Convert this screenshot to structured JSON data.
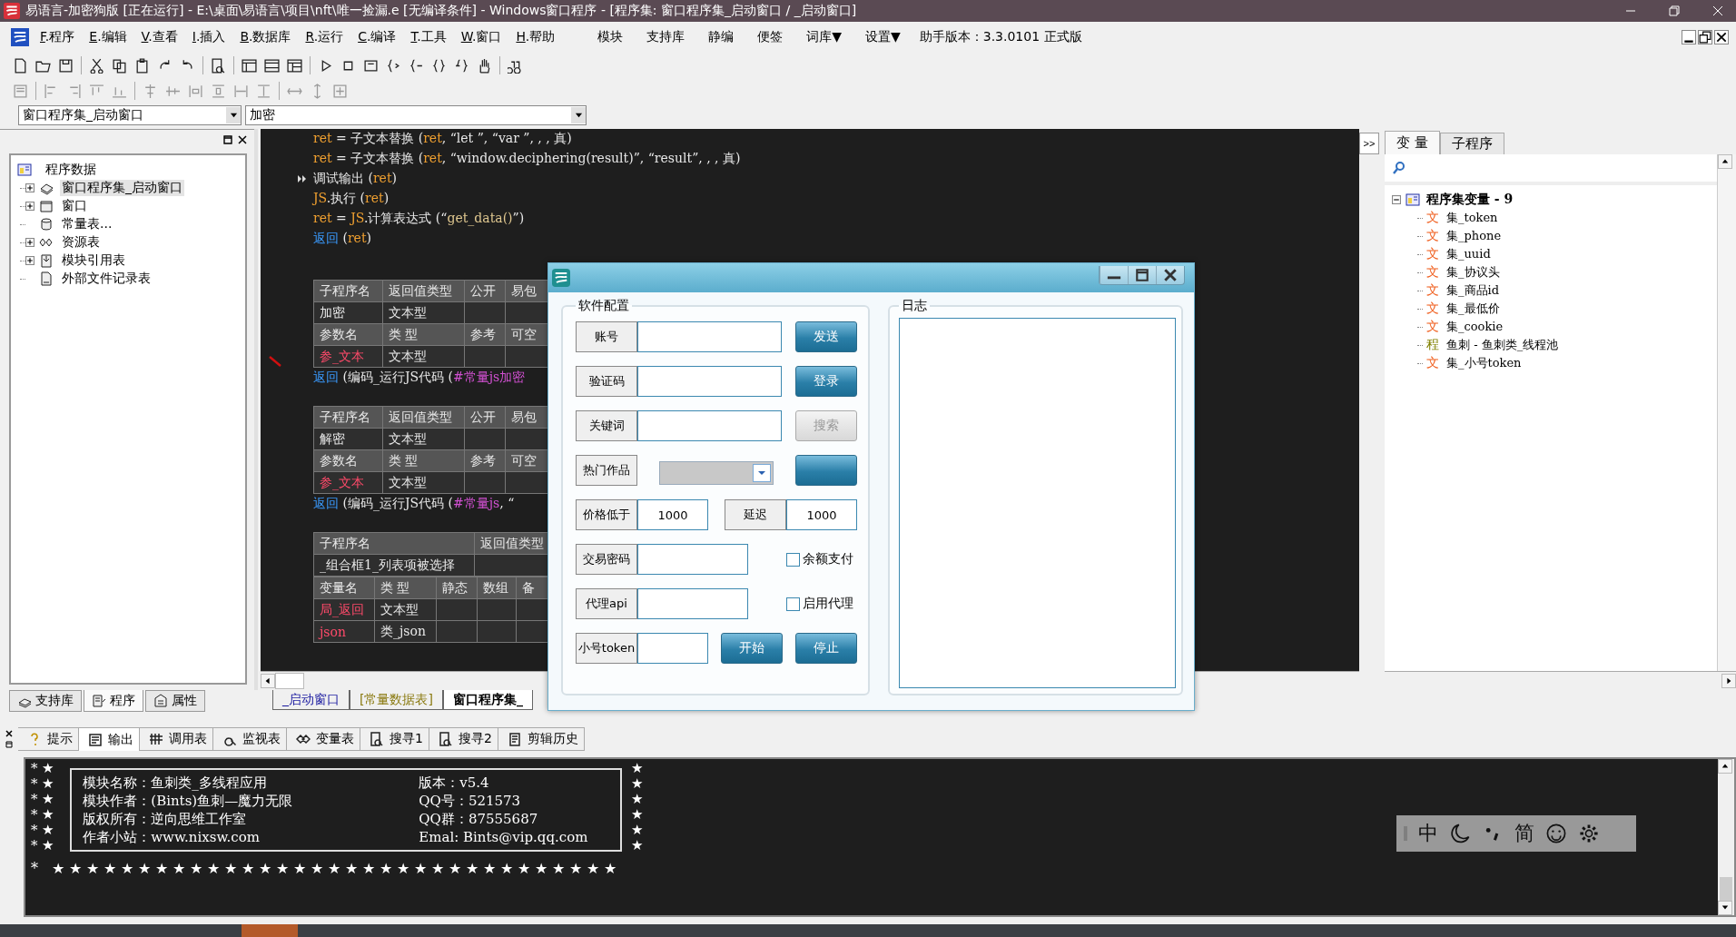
{
  "window": {
    "title": "易语言-加密狗版 [正在运行] - E:\\桌面\\易语言\\项目\\nft\\唯一捡漏.e [无编译条件] - Windows窗口程序 - [程序集: 窗口程序集_启动窗口 / _启动窗口]"
  },
  "menu": {
    "items": [
      {
        "key": "F",
        "label": ".程序"
      },
      {
        "key": "E",
        "label": ".编辑"
      },
      {
        "key": "V",
        "label": ".查看"
      },
      {
        "key": "I",
        "label": ".插入"
      },
      {
        "key": "B",
        "label": ".数据库"
      },
      {
        "key": "R",
        "label": ".运行"
      },
      {
        "key": "C",
        "label": ".编译"
      },
      {
        "key": "T",
        "label": ".工具"
      },
      {
        "key": "W",
        "label": ".窗口"
      },
      {
        "key": "H",
        "label": ".帮助"
      }
    ],
    "extras": [
      "模块",
      "支持库",
      "静编",
      "便签",
      "词库▼",
      "设置▼"
    ],
    "version": "助手版本：3.3.0101 正式版"
  },
  "selectors": {
    "assembly": "窗口程序集_启动窗口",
    "subroutine": "加密"
  },
  "project_tree": {
    "root": "程序数据",
    "children": [
      {
        "label": "窗口程序集_启动窗口",
        "expandable": true,
        "selected": true
      },
      {
        "label": "窗口",
        "expandable": true,
        "selected": false
      },
      {
        "label": "常量表...",
        "expandable": false,
        "selected": false
      },
      {
        "label": "资源表",
        "expandable": true,
        "selected": false
      },
      {
        "label": "模块引用表",
        "expandable": true,
        "selected": false
      },
      {
        "label": "外部文件记录表",
        "expandable": false,
        "selected": false
      }
    ]
  },
  "left_tabs": [
    {
      "label": "支持库",
      "selected": false
    },
    {
      "label": "程序",
      "selected": true
    },
    {
      "label": "属性",
      "selected": false
    }
  ],
  "code_lines": [
    {
      "current": false,
      "segments": [
        {
          "t": "ret",
          "kind": "var"
        },
        {
          "t": " = 子文本替换 (",
          "kind": "plain"
        },
        {
          "t": "ret",
          "kind": "var"
        },
        {
          "t": ", “let ”, “var ”, , , 真)",
          "kind": "plain"
        }
      ]
    },
    {
      "current": false,
      "segments": [
        {
          "t": "ret",
          "kind": "var"
        },
        {
          "t": " = 子文本替换 (",
          "kind": "plain"
        },
        {
          "t": "ret",
          "kind": "var"
        },
        {
          "t": ", “window.deciphering(result)”, “result”, , , 真)",
          "kind": "plain"
        }
      ]
    },
    {
      "current": true,
      "segments": [
        {
          "t": "调试输出 (",
          "kind": "plain"
        },
        {
          "t": "ret",
          "kind": "var"
        },
        {
          "t": ")",
          "kind": "plain"
        }
      ]
    },
    {
      "current": false,
      "segments": [
        {
          "t": "JS",
          "kind": "var"
        },
        {
          "t": ".执行 (",
          "kind": "plain"
        },
        {
          "t": "ret",
          "kind": "var"
        },
        {
          "t": ")",
          "kind": "plain"
        }
      ]
    },
    {
      "current": false,
      "segments": [
        {
          "t": "ret",
          "kind": "var"
        },
        {
          "t": " = ",
          "kind": "plain"
        },
        {
          "t": "JS",
          "kind": "var"
        },
        {
          "t": ".计算表达式 (“",
          "kind": "plain"
        },
        {
          "t": "get_data()",
          "kind": "str"
        },
        {
          "t": "”)",
          "kind": "plain"
        }
      ]
    },
    {
      "current": false,
      "segments": [
        {
          "t": "返回",
          "kind": "kw"
        },
        {
          "t": " (",
          "kind": "plain"
        },
        {
          "t": "ret",
          "kind": "var"
        },
        {
          "t": ")",
          "kind": "plain"
        }
      ]
    }
  ],
  "code_blocks": [
    {
      "kind": "table",
      "rows": [
        {
          "header": true,
          "cells": [
            {
              "t": "子程序名"
            },
            {
              "t": "返回值类型"
            },
            {
              "t": "公开"
            },
            {
              "t": "易包"
            }
          ]
        },
        {
          "header": false,
          "cells": [
            {
              "t": "加密"
            },
            {
              "t": "文本型"
            },
            {},
            {}
          ]
        },
        {
          "header": true,
          "cells": [
            {
              "t": "参数名"
            },
            {
              "t": "类 型"
            },
            {
              "t": "参考"
            },
            {
              "t": "可空"
            }
          ]
        },
        {
          "header": false,
          "cells": [
            {
              "t": "参_文本",
              "red": true
            },
            {
              "t": "文本型"
            },
            {},
            {}
          ]
        }
      ]
    },
    {
      "kind": "line",
      "segments": [
        {
          "t": "返回",
          "kind": "kw"
        },
        {
          "t": " (编码_运行JS代码 (",
          "kind": "plain"
        },
        {
          "t": "#常量js加密",
          "kind": "const"
        }
      ]
    },
    {
      "kind": "table",
      "rows": [
        {
          "header": true,
          "cells": [
            {
              "t": "子程序名"
            },
            {
              "t": "返回值类型"
            },
            {
              "t": "公开"
            },
            {
              "t": "易包"
            }
          ]
        },
        {
          "header": false,
          "cells": [
            {
              "t": "解密"
            },
            {
              "t": "文本型"
            },
            {},
            {}
          ]
        },
        {
          "header": true,
          "cells": [
            {
              "t": "参数名"
            },
            {
              "t": "类 型"
            },
            {
              "t": "参考"
            },
            {
              "t": "可空"
            }
          ]
        },
        {
          "header": false,
          "cells": [
            {
              "t": "参_文本",
              "red": true
            },
            {
              "t": "文本型"
            },
            {},
            {}
          ]
        }
      ]
    },
    {
      "kind": "line",
      "segments": [
        {
          "t": "返回",
          "kind": "kw"
        },
        {
          "t": " (编码_运行JS代码 (",
          "kind": "plain"
        },
        {
          "t": "#常量js",
          "kind": "const"
        },
        {
          "t": ", “",
          "kind": "plain"
        }
      ]
    },
    {
      "kind": "table",
      "rows": [
        {
          "header": true,
          "cells": [
            {
              "t": "子程序名"
            },
            {
              "t": "返回值类型"
            }
          ]
        },
        {
          "header": false,
          "cells": [
            {
              "t": "_组合框1_列表项被选择"
            },
            {}
          ]
        }
      ]
    },
    {
      "kind": "table",
      "rows": [
        {
          "header": true,
          "cells": [
            {
              "t": "变量名"
            },
            {
              "t": "类 型"
            },
            {
              "t": "静态"
            },
            {
              "t": "数组"
            },
            {
              "t": "备"
            }
          ]
        },
        {
          "header": false,
          "cells": [
            {
              "t": "局_返回",
              "red": true
            },
            {
              "t": "文本型"
            },
            {},
            {},
            {}
          ]
        },
        {
          "header": false,
          "cells": [
            {
              "t": "json",
              "red": true
            },
            {
              "t": "类_json"
            },
            {},
            {},
            {}
          ]
        }
      ]
    }
  ],
  "editor_tabs": [
    {
      "label": "_启动窗口",
      "color": "#1a1aa0",
      "selected": false
    },
    {
      "label": "[常量数据表]",
      "color": "#8a7a10",
      "selected": false
    },
    {
      "label": "窗口程序集_",
      "color": "#000000",
      "selected": true
    }
  ],
  "side_panel": {
    "expand_button": ">>",
    "tabs": [
      {
        "label": "变 量",
        "selected": true
      },
      {
        "label": "子程序",
        "selected": false
      }
    ],
    "tree": {
      "root": "程序集变量 - 9",
      "expanded": true,
      "children": [
        {
          "glyph": "文",
          "color": "#f06020",
          "name": "集_token"
        },
        {
          "glyph": "文",
          "color": "#f06020",
          "name": "集_phone"
        },
        {
          "glyph": "文",
          "color": "#f06020",
          "name": "集_uuid"
        },
        {
          "glyph": "文",
          "color": "#f06020",
          "name": "集_协议头"
        },
        {
          "glyph": "文",
          "color": "#f06020",
          "name": "集_商品id"
        },
        {
          "glyph": "文",
          "color": "#f06020",
          "name": "集_最低价"
        },
        {
          "glyph": "文",
          "color": "#f06020",
          "name": "集_cookie"
        },
        {
          "glyph": "程",
          "color": "#808000",
          "name": "鱼刺 - 鱼刺类_线程池"
        },
        {
          "glyph": "文",
          "color": "#f06020",
          "name": "集_小号token"
        }
      ]
    }
  },
  "dialog": {
    "config_group": "软件配置",
    "log_group": "日志",
    "rows": [
      [
        {
          "kind": "field",
          "label": "账号"
        },
        {
          "kind": "button",
          "label": "发送",
          "disabled": false
        }
      ],
      [
        {
          "kind": "field",
          "label": "验证码"
        },
        {
          "kind": "button",
          "label": "登录",
          "disabled": false
        }
      ],
      [
        {
          "kind": "field",
          "label": "关键词"
        },
        {
          "kind": "button",
          "label": "搜索",
          "disabled": true
        }
      ],
      [
        {
          "kind": "combo",
          "label": "热门作品",
          "disabled": true
        },
        {
          "kind": "button",
          "disabled": false
        }
      ],
      [
        {
          "kind": "field",
          "label": "价格低于",
          "value": "1000"
        },
        {
          "kind": "field",
          "label": "延迟",
          "value": "1000"
        }
      ],
      [
        {
          "kind": "field",
          "label": "交易密码"
        },
        {
          "kind": "checkbox",
          "label": "余额支付",
          "checked": false
        }
      ],
      [
        {
          "kind": "field",
          "label": "代理api"
        },
        {
          "kind": "checkbox",
          "label": "启用代理",
          "checked": false
        }
      ],
      [
        {
          "kind": "field",
          "label": "小号token"
        },
        {
          "kind": "button",
          "label": "开始",
          "disabled": false
        },
        {
          "kind": "button",
          "label": "停止",
          "disabled": false
        }
      ]
    ]
  },
  "output_tabs": [
    {
      "label": "提示",
      "selected": false
    },
    {
      "label": "输出",
      "selected": true
    },
    {
      "label": "调用表",
      "selected": false
    },
    {
      "label": "监视表",
      "selected": false
    },
    {
      "label": "变量表",
      "selected": false
    },
    {
      "label": "搜寻1",
      "selected": false
    },
    {
      "label": "搜寻2",
      "selected": false
    },
    {
      "label": "剪辑历史",
      "selected": false
    }
  ],
  "output": {
    "left_column": [
      "* ★",
      "* ★",
      "* ★",
      "* ★",
      "* ★",
      "* ★"
    ],
    "right_column": [
      "★",
      "★",
      "★",
      "★",
      "★",
      "★"
    ],
    "box_lines": [
      {
        "left": "模块名称：鱼刺类_多线程应用",
        "right": "版本：v5.4"
      },
      {
        "left": "模块作者：(Bints)鱼刺—魔力无限",
        "right": "QQ号：521573"
      },
      {
        "left": "版权所有：逆向思维工作室",
        "right": "QQ群：87555687"
      },
      {
        "left": "作者小站：www.nixsw.com",
        "right": "Emal: Bints@vip.qq.com"
      }
    ],
    "bottom_line": "* ★★★★★★★★★★★★★★★★★★★★★★★★★★★★★★★★★"
  },
  "ime_bar": {
    "mode": "中",
    "script": "简"
  }
}
